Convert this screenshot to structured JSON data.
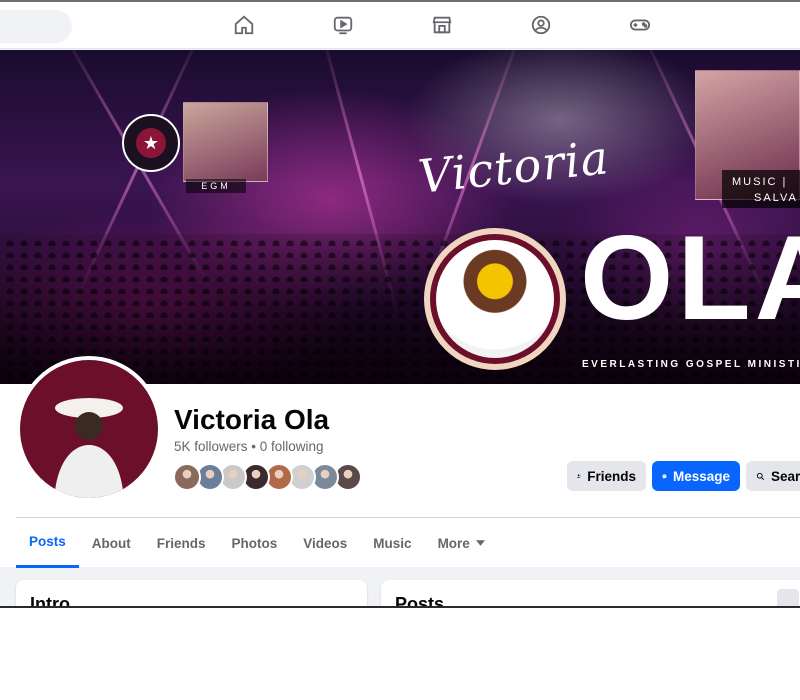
{
  "nav": {
    "icons": [
      "home-icon",
      "video-icon",
      "marketplace-icon",
      "groups-icon",
      "gaming-icon"
    ]
  },
  "cover": {
    "logo_text": "EVERLASTING GOSPEL MINISTRY",
    "egm_label": "EGM",
    "script_name": "Victoria",
    "big_letters": "OLA",
    "music_label_line1": "MUSIC |",
    "music_label_line2": "SALVA",
    "tagline": "EVERLASTING GOSPEL MINISTI"
  },
  "profile": {
    "name": "Victoria Ola",
    "followers_text": "5K followers • 0 following",
    "friend_avatar_colors": [
      "#8a6a5a",
      "#6b7f9a",
      "#c9c9c9",
      "#3a2a2a",
      "#b06a4a",
      "#d0d0d0",
      "#7a8a9a",
      "#5a4a4a"
    ]
  },
  "actions": {
    "friends_label": "Friends",
    "message_label": "Message",
    "search_label": "Search"
  },
  "tabs": {
    "items": [
      {
        "label": "Posts",
        "active": true
      },
      {
        "label": "About"
      },
      {
        "label": "Friends"
      },
      {
        "label": "Photos"
      },
      {
        "label": "Videos"
      },
      {
        "label": "Music"
      },
      {
        "label": "More"
      }
    ]
  },
  "cards": {
    "intro_title": "Intro",
    "posts_title": "Posts"
  },
  "colors": {
    "accent": "#0866ff",
    "brand_maroon": "#6b0f2a"
  }
}
